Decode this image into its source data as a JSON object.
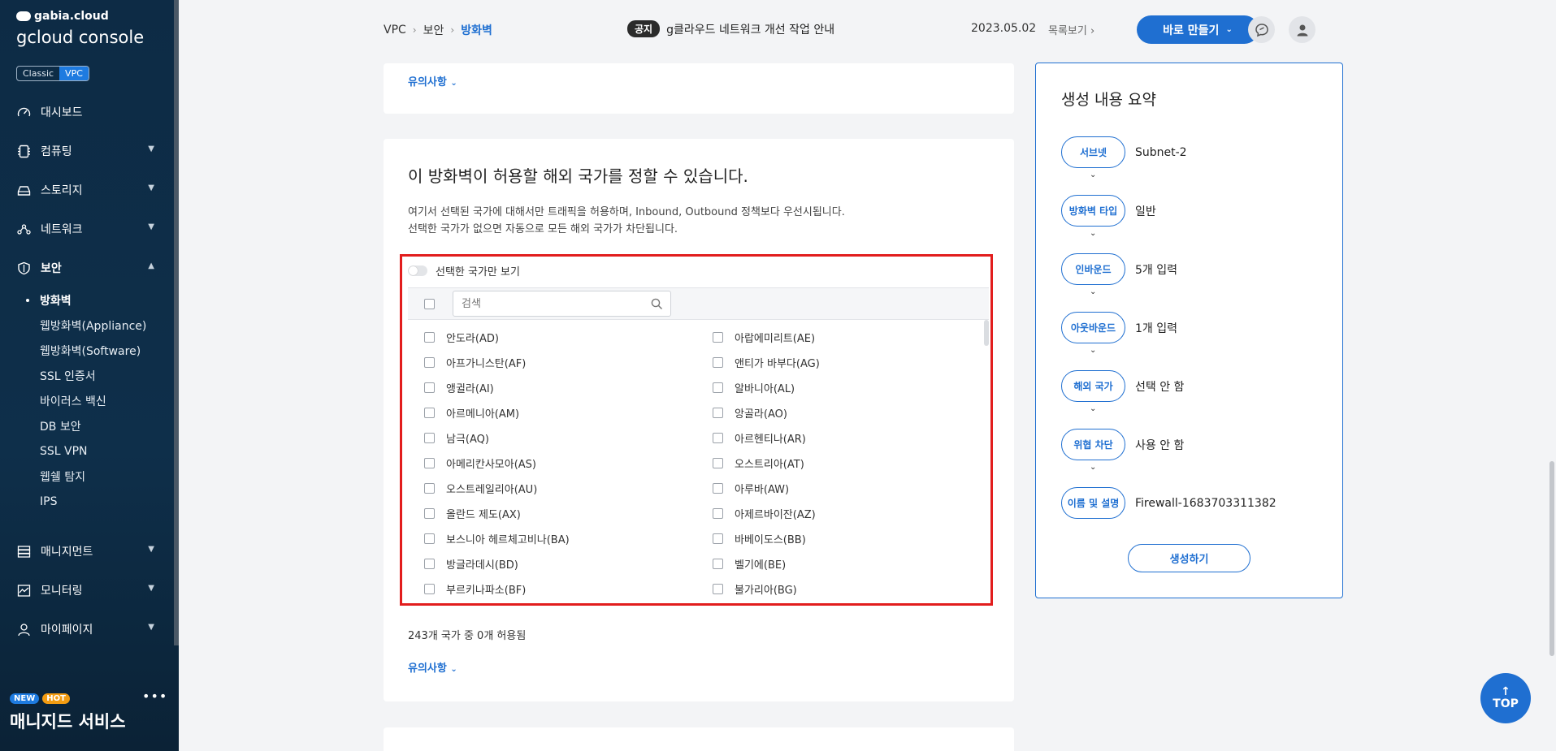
{
  "sidebar": {
    "logo_top": "gabia.cloud",
    "logo_main": "gcloud console",
    "modes": [
      "Classic",
      "VPC"
    ],
    "nav": [
      {
        "label": "대시보드",
        "icon": "dashboard-icon"
      },
      {
        "label": "컴퓨팅",
        "icon": "computing-icon"
      },
      {
        "label": "스토리지",
        "icon": "storage-icon"
      },
      {
        "label": "네트워크",
        "icon": "network-icon"
      },
      {
        "label": "보안",
        "icon": "shield-icon"
      }
    ],
    "security_sub": [
      "방화벽",
      "웹방화벽(Appliance)",
      "웹방화벽(Software)",
      "SSL 인증서",
      "바이러스 백신",
      "DB 보안",
      "SSL VPN",
      "웹쉘 탐지",
      "IPS"
    ],
    "nav_bottom": [
      {
        "label": "매니지먼트",
        "icon": "management-icon"
      },
      {
        "label": "모니터링",
        "icon": "monitoring-icon"
      },
      {
        "label": "마이페이지",
        "icon": "user-icon"
      }
    ],
    "promo": {
      "badge_new": "NEW",
      "badge_hot": "HOT",
      "title": "매니지드 서비스"
    }
  },
  "topbar": {
    "breadcrumb": [
      "VPC",
      "보안",
      "방화벽"
    ],
    "notice_badge": "공지",
    "notice_text": "g클라우드 네트워크 개선 작업 안내",
    "notice_date": "2023.05.02",
    "list_link": "목록보기",
    "create_button": "바로 만들기"
  },
  "card1": {
    "caution_link": "유의사항"
  },
  "country_section": {
    "title": "이 방화벽이 허용할 해외 국가를 정할 수 있습니다.",
    "desc_line1": "여기서 선택된 국가에 대해서만 트래픽을 허용하며, Inbound, Outbound 정책보다 우선시됩니다.",
    "desc_line2": "선택한 국가가 없으면 자동으로 모든 해외 국가가 차단됩니다.",
    "only_selected_label": "선택한 국가만 보기",
    "search_placeholder": "검색",
    "countries_left": [
      "안도라(AD)",
      "아프가니스탄(AF)",
      "앵귈라(AI)",
      "아르메니아(AM)",
      "남극(AQ)",
      "아메리칸사모아(AS)",
      "오스트레일리아(AU)",
      "올란드 제도(AX)",
      "보스니아 헤르체고비나(BA)",
      "방글라데시(BD)",
      "부르키나파소(BF)"
    ],
    "countries_right": [
      "아랍에미리트(AE)",
      "앤티가 바부다(AG)",
      "알바니아(AL)",
      "앙골라(AO)",
      "아르헨티나(AR)",
      "오스트리아(AT)",
      "아루바(AW)",
      "아제르바이잔(AZ)",
      "바베이도스(BB)",
      "벨기에(BE)",
      "불가리아(BG)"
    ],
    "count_text": "243개 국가 중 0개 허용됨",
    "caution_link": "유의사항"
  },
  "summary": {
    "title": "생성 내용 요약",
    "steps": [
      {
        "label": "서브넷",
        "value": "Subnet-2"
      },
      {
        "label": "방화벽 타입",
        "value": "일반"
      },
      {
        "label": "인바운드",
        "value": "5개 입력"
      },
      {
        "label": "아웃바운드",
        "value": "1개 입력"
      },
      {
        "label": "해외 국가",
        "value": "선택 안 함"
      },
      {
        "label": "위협 차단",
        "value": "사용 안 함"
      },
      {
        "label": "이름 및 설명",
        "value": "Firewall-1683703311382"
      }
    ],
    "generate_button": "생성하기"
  },
  "top_button": "TOP",
  "colors": {
    "accent": "#1f6fd1",
    "highlight_border": "#e21d1d",
    "sidebar_bg": "#0d2b45"
  }
}
